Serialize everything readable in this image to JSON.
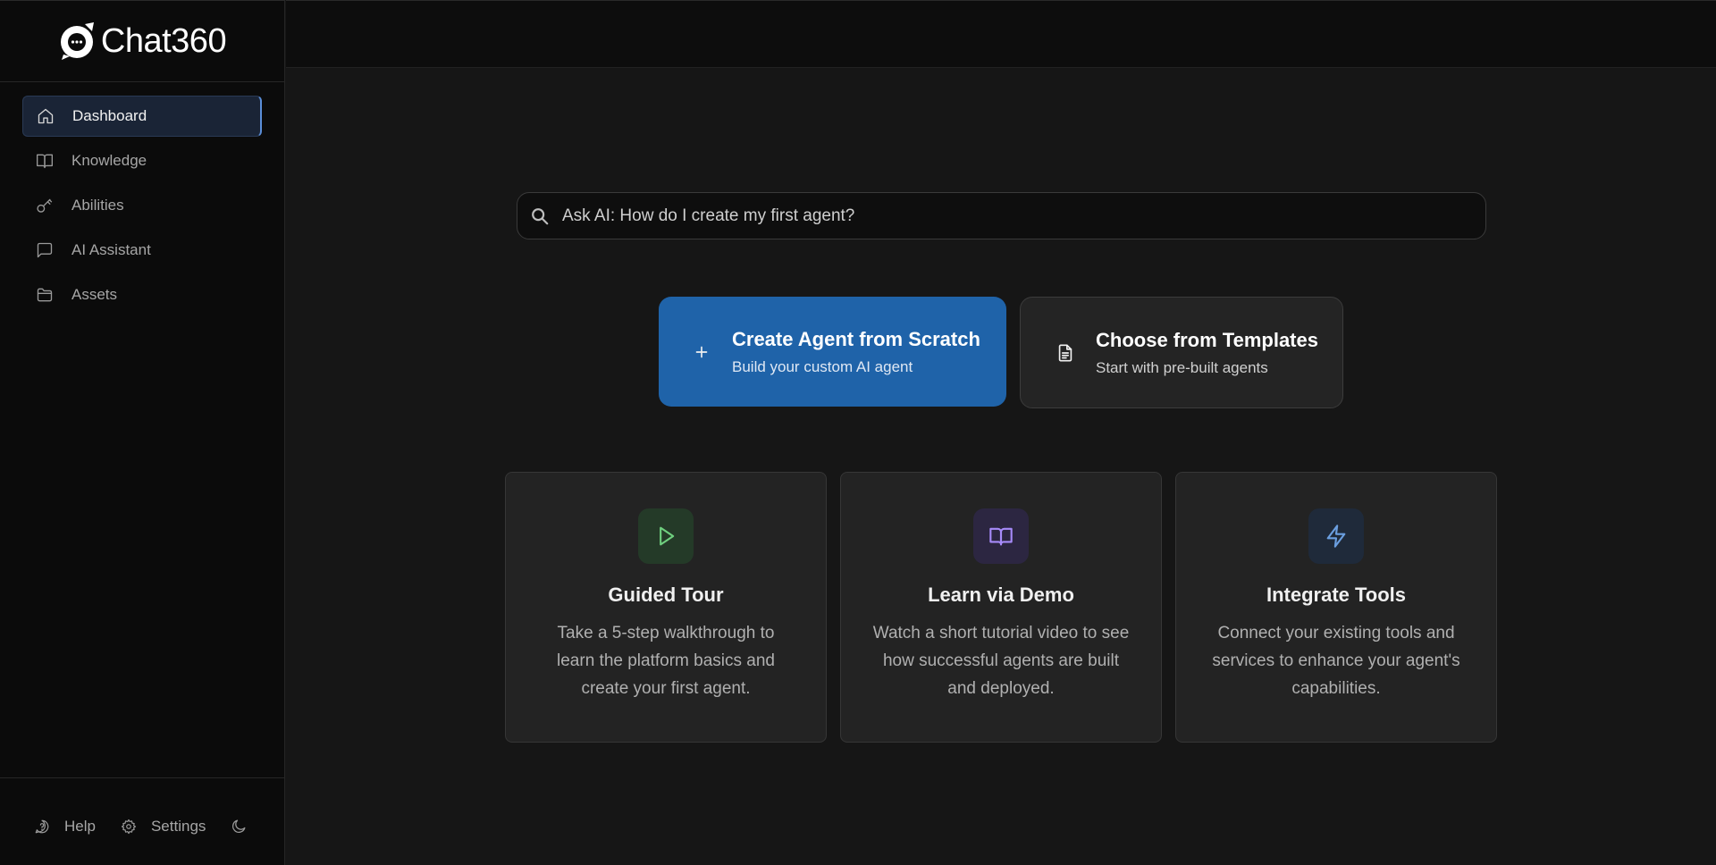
{
  "app": {
    "logo_text": "Chat360"
  },
  "sidebar": {
    "items": [
      {
        "label": "Dashboard",
        "icon": "home-icon",
        "active": true
      },
      {
        "label": "Knowledge",
        "icon": "book-icon",
        "active": false
      },
      {
        "label": "Abilities",
        "icon": "key-icon",
        "active": false
      },
      {
        "label": "AI Assistant",
        "icon": "message-square-icon",
        "active": false
      },
      {
        "label": "Assets",
        "icon": "folder-icon",
        "active": false
      }
    ],
    "footer": {
      "help_label": "Help",
      "settings_label": "Settings",
      "theme_icon": "moon-icon"
    }
  },
  "search": {
    "placeholder": "Ask AI: How do I create my first agent?",
    "icon": "search-icon"
  },
  "actions": {
    "create": {
      "title": "Create Agent from Scratch",
      "subtitle": "Build your custom AI agent",
      "icon": "plus-icon",
      "color": "#1f63a9"
    },
    "templates": {
      "title": "Choose from Templates",
      "subtitle": "Start with pre-built agents",
      "icon": "file-text-icon"
    }
  },
  "cards": [
    {
      "title": "Guided Tour",
      "description": "Take a 5-step walkthrough to learn the platform basics and create your first agent.",
      "icon": "play-icon",
      "accent": "#6fcf7f"
    },
    {
      "title": "Learn via Demo",
      "description": "Watch a short tutorial video to see how successful agents are built and deployed.",
      "icon": "book-open-icon",
      "accent": "#a78bfa"
    },
    {
      "title": "Integrate Tools",
      "description": "Connect your existing tools and services to enhance your agent's capabilities.",
      "icon": "zap-icon",
      "accent": "#6b9fe0"
    }
  ]
}
